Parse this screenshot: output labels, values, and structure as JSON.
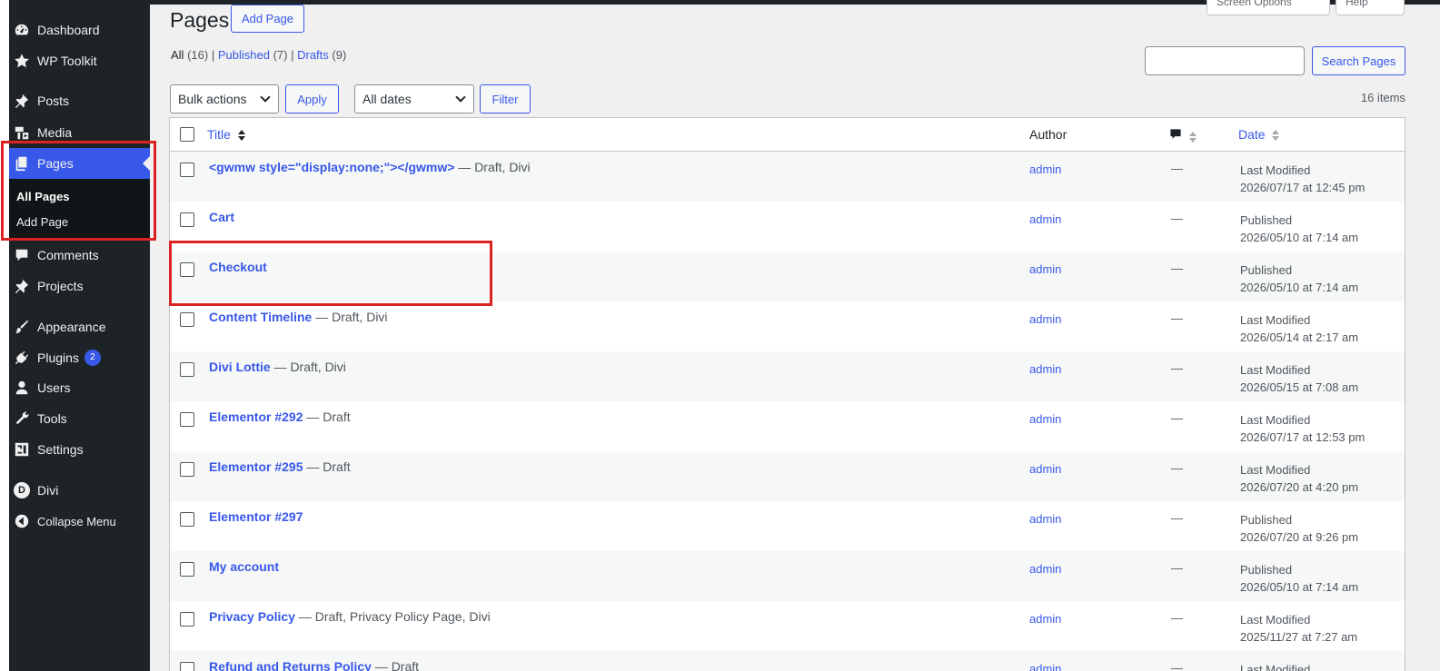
{
  "sidebar": {
    "items": [
      {
        "label": "Dashboard",
        "icon": "dashboard-icon"
      },
      {
        "label": "WP Toolkit",
        "icon": "star-icon"
      },
      {
        "label": "Posts",
        "icon": "pin-icon"
      },
      {
        "label": "Media",
        "icon": "media-icon"
      },
      {
        "label": "Pages",
        "icon": "pages-icon"
      },
      {
        "label": "Comments",
        "icon": "comment-icon"
      },
      {
        "label": "Projects",
        "icon": "pin-icon"
      },
      {
        "label": "Appearance",
        "icon": "brush-icon"
      },
      {
        "label": "Plugins",
        "icon": "plugin-icon",
        "badge": "2"
      },
      {
        "label": "Users",
        "icon": "user-icon"
      },
      {
        "label": "Tools",
        "icon": "wrench-icon"
      },
      {
        "label": "Settings",
        "icon": "settings-icon"
      },
      {
        "label": "Divi",
        "icon": "divi-icon",
        "glyph": "D"
      },
      {
        "label": "Collapse Menu",
        "icon": "collapse-icon"
      }
    ],
    "submenu": {
      "all_pages": "All Pages",
      "add_page": "Add Page"
    }
  },
  "header": {
    "title": "Pages",
    "add_new": "Add Page",
    "screen_options": "Screen Options",
    "help": "Help"
  },
  "filters": {
    "all_label": "All",
    "all_count": "(16)",
    "published_label": "Published",
    "published_count": "(7)",
    "drafts_label": "Drafts",
    "drafts_count": "(9)",
    "separator": "|"
  },
  "search": {
    "value": "",
    "button": "Search Pages"
  },
  "tablenav": {
    "bulk_actions": "Bulk actions",
    "apply": "Apply",
    "dates": "All dates",
    "filter": "Filter",
    "items_count": "16 items"
  },
  "table": {
    "columns": {
      "title": "Title",
      "author": "Author",
      "date": "Date"
    },
    "rows": [
      {
        "title": "<gwmw style=\"display:none;\"></gwmw>",
        "state": " — Draft, Divi",
        "author": "admin",
        "comments": "—",
        "status": "Last Modified",
        "date": "2026/07/17 at 12:45 pm"
      },
      {
        "title": "Cart",
        "state": "",
        "author": "admin",
        "comments": "—",
        "status": "Published",
        "date": "2026/05/10 at 7:14 am"
      },
      {
        "title": "Checkout",
        "state": "",
        "author": "admin",
        "comments": "—",
        "status": "Published",
        "date": "2026/05/10 at 7:14 am"
      },
      {
        "title": "Content Timeline",
        "state": " — Draft, Divi",
        "author": "admin",
        "comments": "—",
        "status": "Last Modified",
        "date": "2026/05/14 at 2:17 am"
      },
      {
        "title": "Divi Lottie",
        "state": " — Draft, Divi",
        "author": "admin",
        "comments": "—",
        "status": "Last Modified",
        "date": "2026/05/15 at 7:08 am"
      },
      {
        "title": "Elementor #292",
        "state": " — Draft",
        "author": "admin",
        "comments": "—",
        "status": "Last Modified",
        "date": "2026/07/17 at 12:53 pm"
      },
      {
        "title": "Elementor #295",
        "state": " — Draft",
        "author": "admin",
        "comments": "—",
        "status": "Last Modified",
        "date": "2026/07/20 at 4:20 pm"
      },
      {
        "title": "Elementor #297",
        "state": "",
        "author": "admin",
        "comments": "—",
        "status": "Published",
        "date": "2026/07/20 at 9:26 pm"
      },
      {
        "title": "My account",
        "state": "",
        "author": "admin",
        "comments": "—",
        "status": "Published",
        "date": "2026/05/10 at 7:14 am"
      },
      {
        "title": "Privacy Policy",
        "state": " — Draft, Privacy Policy Page, Divi",
        "author": "admin",
        "comments": "—",
        "status": "Last Modified",
        "date": "2025/11/27 at 7:27 am"
      },
      {
        "title": "Refund and Returns Policy",
        "state": " — Draft",
        "author": "admin",
        "comments": "—",
        "status": "Last Modified",
        "date": ""
      }
    ]
  },
  "colors": {
    "accent": "#3858e9",
    "sidebar": "#1d2327",
    "highlight": "#d22222"
  }
}
